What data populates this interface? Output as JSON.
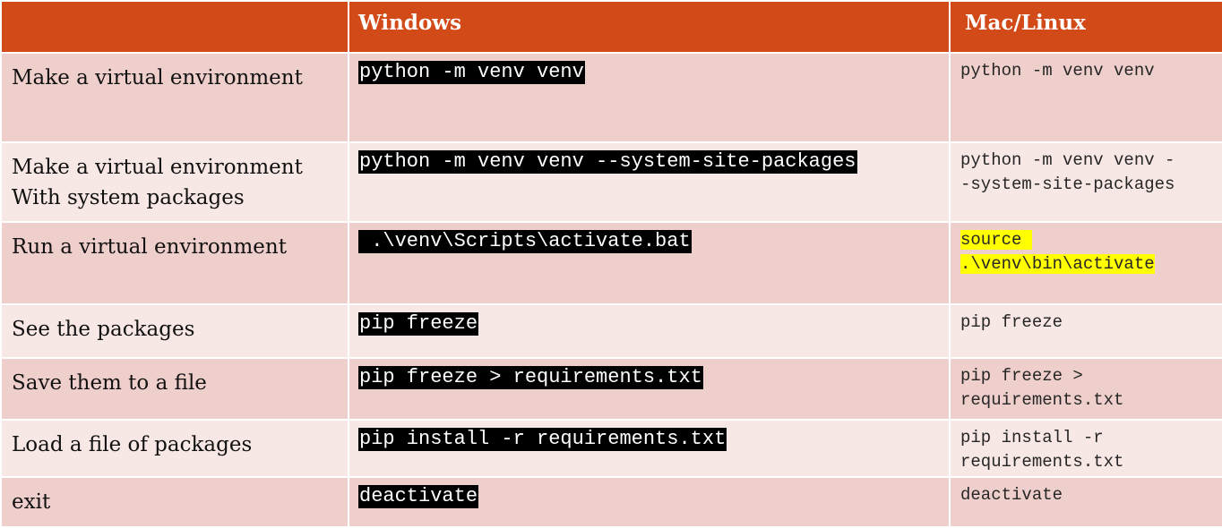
{
  "header": {
    "col1": "",
    "col2": "Windows",
    "col3": "Mac/Linux"
  },
  "rows": [
    {
      "task": "Make a virtual environment",
      "windows": "python -m venv venv",
      "mac": "python -m venv venv"
    },
    {
      "task": "Make a virtual environment\nWith system packages",
      "windows": "python -m venv venv --system-site-packages",
      "mac": "python -m venv venv -\n-system-site-packages"
    },
    {
      "task": "Run a virtual environment",
      "windows": " .\\venv\\Scripts\\activate.bat",
      "mac_line1": "source ",
      "mac_line2": ".\\venv\\bin\\activate"
    },
    {
      "task": "See the packages",
      "windows": "pip freeze",
      "mac": "pip freeze"
    },
    {
      "task": "Save them to a file",
      "windows": "pip freeze > requirements.txt",
      "mac": "pip freeze >\nrequirements.txt"
    },
    {
      "task": "Load a file of packages",
      "windows": "pip install -r requirements.txt",
      "mac": "pip install -r\nrequirements.txt"
    },
    {
      "task": "exit",
      "windows": "deactivate",
      "mac": "deactivate"
    }
  ],
  "colors": {
    "header_bg": "#d24a17",
    "row_odd_bg": "#efcfcb",
    "row_even_bg": "#f7e7e5",
    "command_bg": "#000000",
    "highlight": "#ffff00"
  }
}
